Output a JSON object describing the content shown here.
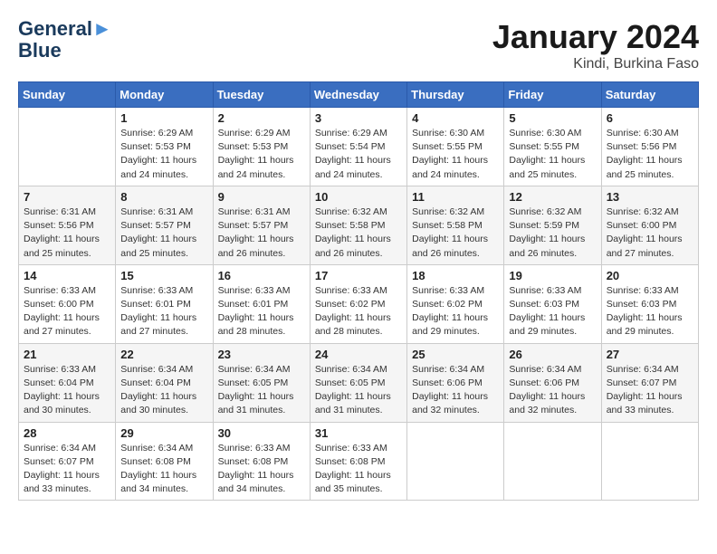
{
  "header": {
    "logo_line1": "General",
    "logo_line2": "Blue",
    "main_title": "January 2024",
    "subtitle": "Kindi, Burkina Faso"
  },
  "calendar": {
    "weekdays": [
      "Sunday",
      "Monday",
      "Tuesday",
      "Wednesday",
      "Thursday",
      "Friday",
      "Saturday"
    ],
    "weeks": [
      [
        {
          "day": "",
          "sunrise": "",
          "sunset": "",
          "daylight": ""
        },
        {
          "day": "1",
          "sunrise": "Sunrise: 6:29 AM",
          "sunset": "Sunset: 5:53 PM",
          "daylight": "Daylight: 11 hours and 24 minutes."
        },
        {
          "day": "2",
          "sunrise": "Sunrise: 6:29 AM",
          "sunset": "Sunset: 5:53 PM",
          "daylight": "Daylight: 11 hours and 24 minutes."
        },
        {
          "day": "3",
          "sunrise": "Sunrise: 6:29 AM",
          "sunset": "Sunset: 5:54 PM",
          "daylight": "Daylight: 11 hours and 24 minutes."
        },
        {
          "day": "4",
          "sunrise": "Sunrise: 6:30 AM",
          "sunset": "Sunset: 5:55 PM",
          "daylight": "Daylight: 11 hours and 24 minutes."
        },
        {
          "day": "5",
          "sunrise": "Sunrise: 6:30 AM",
          "sunset": "Sunset: 5:55 PM",
          "daylight": "Daylight: 11 hours and 25 minutes."
        },
        {
          "day": "6",
          "sunrise": "Sunrise: 6:30 AM",
          "sunset": "Sunset: 5:56 PM",
          "daylight": "Daylight: 11 hours and 25 minutes."
        }
      ],
      [
        {
          "day": "7",
          "sunrise": "Sunrise: 6:31 AM",
          "sunset": "Sunset: 5:56 PM",
          "daylight": "Daylight: 11 hours and 25 minutes."
        },
        {
          "day": "8",
          "sunrise": "Sunrise: 6:31 AM",
          "sunset": "Sunset: 5:57 PM",
          "daylight": "Daylight: 11 hours and 25 minutes."
        },
        {
          "day": "9",
          "sunrise": "Sunrise: 6:31 AM",
          "sunset": "Sunset: 5:57 PM",
          "daylight": "Daylight: 11 hours and 26 minutes."
        },
        {
          "day": "10",
          "sunrise": "Sunrise: 6:32 AM",
          "sunset": "Sunset: 5:58 PM",
          "daylight": "Daylight: 11 hours and 26 minutes."
        },
        {
          "day": "11",
          "sunrise": "Sunrise: 6:32 AM",
          "sunset": "Sunset: 5:58 PM",
          "daylight": "Daylight: 11 hours and 26 minutes."
        },
        {
          "day": "12",
          "sunrise": "Sunrise: 6:32 AM",
          "sunset": "Sunset: 5:59 PM",
          "daylight": "Daylight: 11 hours and 26 minutes."
        },
        {
          "day": "13",
          "sunrise": "Sunrise: 6:32 AM",
          "sunset": "Sunset: 6:00 PM",
          "daylight": "Daylight: 11 hours and 27 minutes."
        }
      ],
      [
        {
          "day": "14",
          "sunrise": "Sunrise: 6:33 AM",
          "sunset": "Sunset: 6:00 PM",
          "daylight": "Daylight: 11 hours and 27 minutes."
        },
        {
          "day": "15",
          "sunrise": "Sunrise: 6:33 AM",
          "sunset": "Sunset: 6:01 PM",
          "daylight": "Daylight: 11 hours and 27 minutes."
        },
        {
          "day": "16",
          "sunrise": "Sunrise: 6:33 AM",
          "sunset": "Sunset: 6:01 PM",
          "daylight": "Daylight: 11 hours and 28 minutes."
        },
        {
          "day": "17",
          "sunrise": "Sunrise: 6:33 AM",
          "sunset": "Sunset: 6:02 PM",
          "daylight": "Daylight: 11 hours and 28 minutes."
        },
        {
          "day": "18",
          "sunrise": "Sunrise: 6:33 AM",
          "sunset": "Sunset: 6:02 PM",
          "daylight": "Daylight: 11 hours and 29 minutes."
        },
        {
          "day": "19",
          "sunrise": "Sunrise: 6:33 AM",
          "sunset": "Sunset: 6:03 PM",
          "daylight": "Daylight: 11 hours and 29 minutes."
        },
        {
          "day": "20",
          "sunrise": "Sunrise: 6:33 AM",
          "sunset": "Sunset: 6:03 PM",
          "daylight": "Daylight: 11 hours and 29 minutes."
        }
      ],
      [
        {
          "day": "21",
          "sunrise": "Sunrise: 6:33 AM",
          "sunset": "Sunset: 6:04 PM",
          "daylight": "Daylight: 11 hours and 30 minutes."
        },
        {
          "day": "22",
          "sunrise": "Sunrise: 6:34 AM",
          "sunset": "Sunset: 6:04 PM",
          "daylight": "Daylight: 11 hours and 30 minutes."
        },
        {
          "day": "23",
          "sunrise": "Sunrise: 6:34 AM",
          "sunset": "Sunset: 6:05 PM",
          "daylight": "Daylight: 11 hours and 31 minutes."
        },
        {
          "day": "24",
          "sunrise": "Sunrise: 6:34 AM",
          "sunset": "Sunset: 6:05 PM",
          "daylight": "Daylight: 11 hours and 31 minutes."
        },
        {
          "day": "25",
          "sunrise": "Sunrise: 6:34 AM",
          "sunset": "Sunset: 6:06 PM",
          "daylight": "Daylight: 11 hours and 32 minutes."
        },
        {
          "day": "26",
          "sunrise": "Sunrise: 6:34 AM",
          "sunset": "Sunset: 6:06 PM",
          "daylight": "Daylight: 11 hours and 32 minutes."
        },
        {
          "day": "27",
          "sunrise": "Sunrise: 6:34 AM",
          "sunset": "Sunset: 6:07 PM",
          "daylight": "Daylight: 11 hours and 33 minutes."
        }
      ],
      [
        {
          "day": "28",
          "sunrise": "Sunrise: 6:34 AM",
          "sunset": "Sunset: 6:07 PM",
          "daylight": "Daylight: 11 hours and 33 minutes."
        },
        {
          "day": "29",
          "sunrise": "Sunrise: 6:34 AM",
          "sunset": "Sunset: 6:08 PM",
          "daylight": "Daylight: 11 hours and 34 minutes."
        },
        {
          "day": "30",
          "sunrise": "Sunrise: 6:33 AM",
          "sunset": "Sunset: 6:08 PM",
          "daylight": "Daylight: 11 hours and 34 minutes."
        },
        {
          "day": "31",
          "sunrise": "Sunrise: 6:33 AM",
          "sunset": "Sunset: 6:08 PM",
          "daylight": "Daylight: 11 hours and 35 minutes."
        },
        {
          "day": "",
          "sunrise": "",
          "sunset": "",
          "daylight": ""
        },
        {
          "day": "",
          "sunrise": "",
          "sunset": "",
          "daylight": ""
        },
        {
          "day": "",
          "sunrise": "",
          "sunset": "",
          "daylight": ""
        }
      ]
    ]
  }
}
